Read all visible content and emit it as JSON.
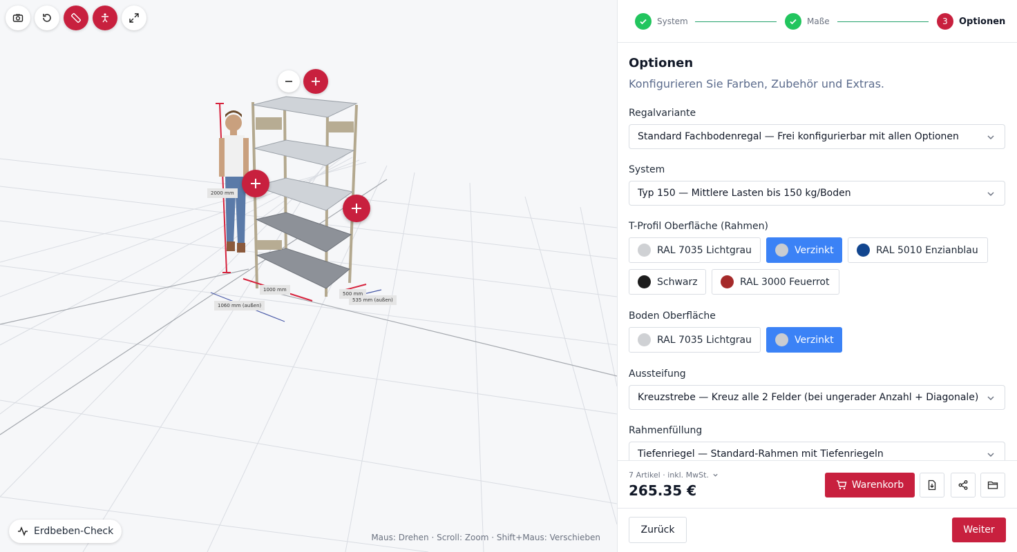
{
  "viewport": {
    "toolbar": [
      "camera-icon",
      "reset-icon",
      "ruler-icon",
      "person-icon",
      "fullscreen-icon"
    ],
    "dimensions": {
      "height": "2000 mm",
      "width_inner": "1000 mm",
      "width_outer": "1060 mm (außen)",
      "depth_inner": "500 mm",
      "depth_outer": "535 mm (außen)"
    },
    "quake_button": "Erdbeben-Check",
    "hint": "Maus: Drehen · Scroll: Zoom · Shift+Maus: Verschieben"
  },
  "stepper": {
    "steps": [
      {
        "label": "System",
        "state": "done"
      },
      {
        "label": "Maße",
        "state": "done"
      },
      {
        "label": "Optionen",
        "state": "active",
        "number": "3"
      }
    ]
  },
  "options": {
    "title": "Optionen",
    "subtitle": "Konfigurieren Sie Farben, Zubehör und Extras.",
    "variant": {
      "label": "Regalvariante",
      "value": "Standard Fachbodenregal — Frei konfigurierbar mit allen Optionen"
    },
    "system": {
      "label": "System",
      "value": "Typ 150 — Mittlere Lasten bis 150 kg/Boden"
    },
    "frame_surface": {
      "label": "T-Profil Oberfläche (Rahmen)",
      "choices": [
        {
          "label": "RAL 7035 Lichtgrau",
          "color": "#cfd1d4",
          "selected": false
        },
        {
          "label": "Verzinkt",
          "color": "#c9ccd1",
          "selected": true
        },
        {
          "label": "RAL 5010 Enzianblau",
          "color": "#12468f",
          "selected": false
        },
        {
          "label": "Schwarz",
          "color": "#1c1c1c",
          "selected": false
        },
        {
          "label": "RAL 3000 Feuerrot",
          "color": "#a52a2a",
          "selected": false
        }
      ]
    },
    "shelf_surface": {
      "label": "Boden Oberfläche",
      "choices": [
        {
          "label": "RAL 7035 Lichtgrau",
          "color": "#cfd1d4",
          "selected": false
        },
        {
          "label": "Verzinkt",
          "color": "#c9ccd1",
          "selected": true
        }
      ]
    },
    "bracing": {
      "label": "Aussteifung",
      "value": "Kreuzstrebe — Kreuz alle 2 Felder (bei ungerader Anzahl + Diagonale)"
    },
    "frame_fill": {
      "label": "Rahmenfüllung",
      "value": "Tiefenriegel — Standard-Rahmen mit Tiefenriegeln"
    }
  },
  "footer": {
    "articles": "7 Artikel · inkl. MwSt.",
    "price": "265.35 €",
    "cart_label": "Warenkorb",
    "back_label": "Zurück",
    "next_label": "Weiter"
  },
  "colors": {
    "accent": "#c8203e",
    "selected": "#3b82f6",
    "success": "#22c55e"
  }
}
